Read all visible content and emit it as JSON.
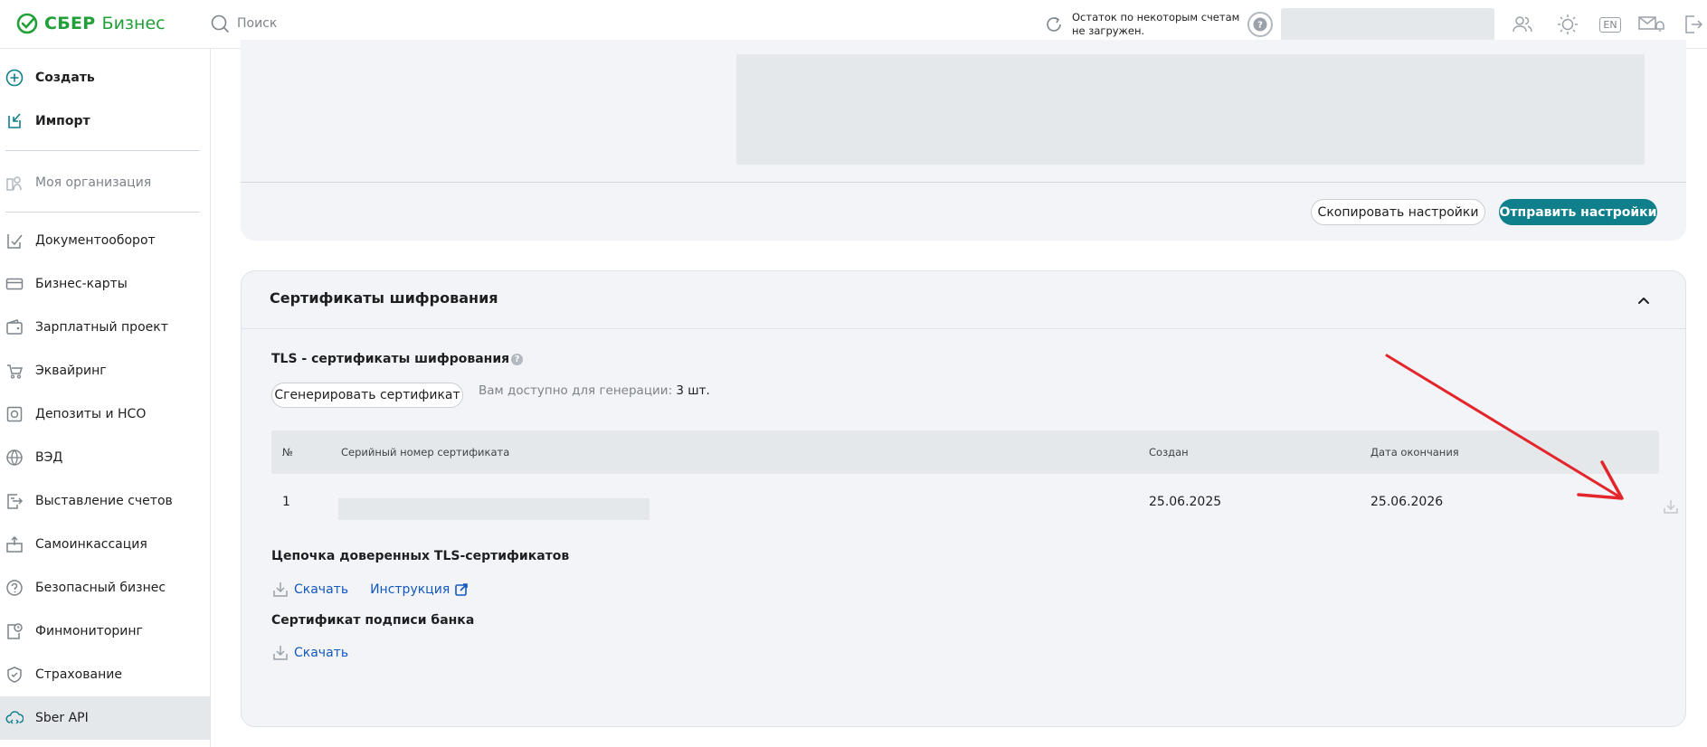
{
  "header": {
    "logo_sber": "СБЕР",
    "logo_business": "Бизнес",
    "search_placeholder": "Поиск",
    "balance_line1": "Остаток по некоторым счетам",
    "balance_line2": "не загружен.",
    "lang": "EN"
  },
  "sidebar": {
    "items": [
      {
        "label": "Создать",
        "icon": "plus-circle-icon"
      },
      {
        "label": "Импорт",
        "icon": "import-icon"
      },
      {
        "label": "Моя организация",
        "icon": "organization-icon"
      },
      {
        "label": "Документооборот",
        "icon": "document-flow-icon"
      },
      {
        "label": "Бизнес-карты",
        "icon": "card-icon"
      },
      {
        "label": "Зарплатный проект",
        "icon": "wallet-icon"
      },
      {
        "label": "Эквайринг",
        "icon": "acquiring-icon"
      },
      {
        "label": "Депозиты и НСО",
        "icon": "deposit-icon"
      },
      {
        "label": "ВЭД",
        "icon": "globe-icon"
      },
      {
        "label": "Выставление счетов",
        "icon": "invoice-icon"
      },
      {
        "label": "Самоинкассация",
        "icon": "cash-collection-icon"
      },
      {
        "label": "Безопасный бизнес",
        "icon": "safe-business-icon"
      },
      {
        "label": "Финмониторинг",
        "icon": "finmonitoring-icon"
      },
      {
        "label": "Страхование",
        "icon": "insurance-icon"
      },
      {
        "label": "Sber API",
        "icon": "cloud-api-icon"
      }
    ]
  },
  "settings_panel": {
    "copy_button": "Скопировать настройки",
    "send_button": "Отправить настройки"
  },
  "certificates": {
    "title": "Сертификаты шифрования",
    "tls_title": "TLS - сертификаты шифрования",
    "help": "?",
    "generate_button": "Сгенерировать сертификат",
    "available_label": "Вам доступно для генерации:",
    "available_value": "3 шт.",
    "table": {
      "columns": [
        "№",
        "Серийный номер сертификата",
        "Создан",
        "Дата окончания"
      ],
      "rows": [
        {
          "num": "1",
          "created": "25.06.2025",
          "expires": "25.06.2026"
        }
      ]
    },
    "chain_title": "Цепочка доверенных TLS-сертификатов",
    "chain_download": "Скачать",
    "chain_instruction": "Инструкция",
    "bank_sign_title": "Сертификат подписи банка",
    "bank_sign_download": "Скачать"
  },
  "colors": {
    "brand_green": "#21a038",
    "primary_teal": "#107f8c",
    "link_blue": "#1358bf",
    "annotation_red": "#e3262b"
  }
}
